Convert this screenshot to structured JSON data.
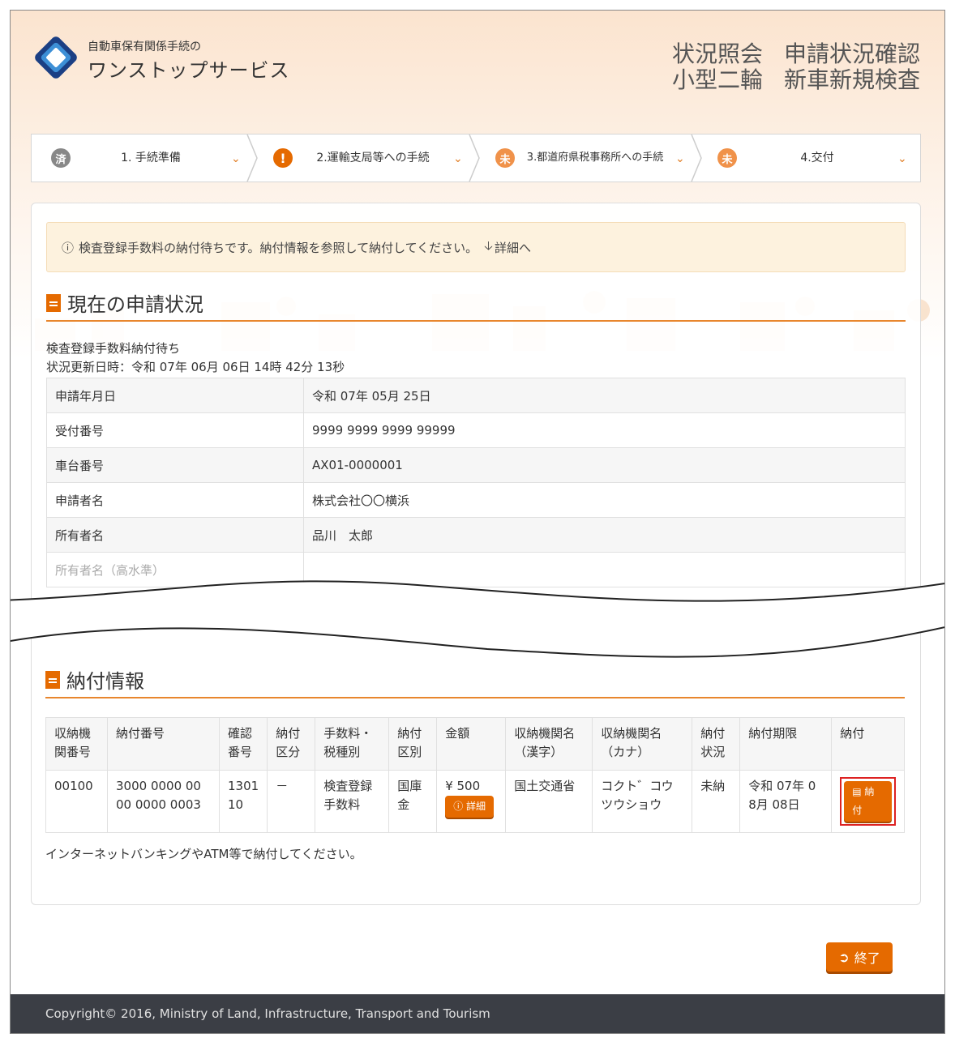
{
  "logo": {
    "sub": "自動車保有関係手続の",
    "main": "ワンストップサービス"
  },
  "title": {
    "line1_a": "状況照会",
    "line1_b": "申請状況確認",
    "line2_a": "小型二輪",
    "line2_b": "新車新規検査"
  },
  "steps": [
    {
      "badge": "済",
      "label": "1. 手続準備",
      "state": "done"
    },
    {
      "badge": "!",
      "label": "2.運輸支局等への手続",
      "state": "warn"
    },
    {
      "badge": "未",
      "label": "3.都道府県税事務所への手続",
      "state": "todo"
    },
    {
      "badge": "未",
      "label": "4.交付",
      "state": "todo"
    }
  ],
  "alert": {
    "text": "検査登録手数料の納付待ちです。納付情報を参照して納付してください。",
    "link": "詳細へ"
  },
  "status_section": {
    "heading": "現在の申請状況",
    "status": "検査登録手数料納付待ち",
    "updated": "状況更新日時：令和 07年 06月 06日 14時 42分 13秒",
    "rows": [
      {
        "key": "申請年月日",
        "value": "令和 07年 05月 25日"
      },
      {
        "key": "受付番号",
        "value": "9999 9999 9999 99999"
      },
      {
        "key": "車台番号",
        "value": "AX01-0000001"
      },
      {
        "key": "申請者名",
        "value": "株式会社〇〇横浜"
      },
      {
        "key": "所有者名",
        "value": "品川　太郎"
      },
      {
        "key": "所有者名（高水準）",
        "value": ""
      }
    ]
  },
  "payment_section": {
    "heading": "納付情報",
    "headers": [
      "収納機関番号",
      "納付番号",
      "確認番号",
      "納付区分",
      "手数料・税種別",
      "納付区別",
      "金額",
      "収納機関名（漢字）",
      "収納機関名（カナ）",
      "納付状況",
      "納付期限",
      "納付"
    ],
    "headers_lines": [
      [
        "収納機",
        "関番号"
      ],
      [
        "納付番号",
        ""
      ],
      [
        "確認",
        "番号"
      ],
      [
        "納付",
        "区分"
      ],
      [
        "手数料・",
        "税種別"
      ],
      [
        "納付",
        "区別"
      ],
      [
        "金額",
        ""
      ],
      [
        "収納機関名",
        "（漢字）"
      ],
      [
        "収納機関名",
        "（カナ）"
      ],
      [
        "納付",
        "状況"
      ],
      [
        "納付期限",
        ""
      ],
      [
        "納付",
        ""
      ]
    ],
    "row": {
      "agency_no": "00100",
      "pay_no_1": "3000 0000 00",
      "pay_no_2": "00 0000 0003",
      "confirm_1": "1301",
      "confirm_2": "10",
      "pay_class": "－",
      "fee_1": "検査登録",
      "fee_2": "手数料",
      "kubetsu_1": "国庫",
      "kubetsu_2": "金",
      "amount": "¥ 500",
      "detail_btn": "詳細",
      "agency_kanji": "国土交通省",
      "agency_kana_1": "コクト゛コウ",
      "agency_kana_2": "ツウショウ",
      "status": "未納",
      "deadline_1": "令和 07年 0",
      "deadline_2": "8月 08日",
      "pay_btn": "納付"
    },
    "note": "インターネットバンキングやATM等で納付してください。"
  },
  "end_button": "終了",
  "footer": "Copyright© 2016, Ministry of Land, Infrastructure, Transport and Tourism",
  "colors": {
    "accent": "#e56a00",
    "footer_bg": "#3b3e45",
    "alert_bg": "#fdf2de"
  }
}
